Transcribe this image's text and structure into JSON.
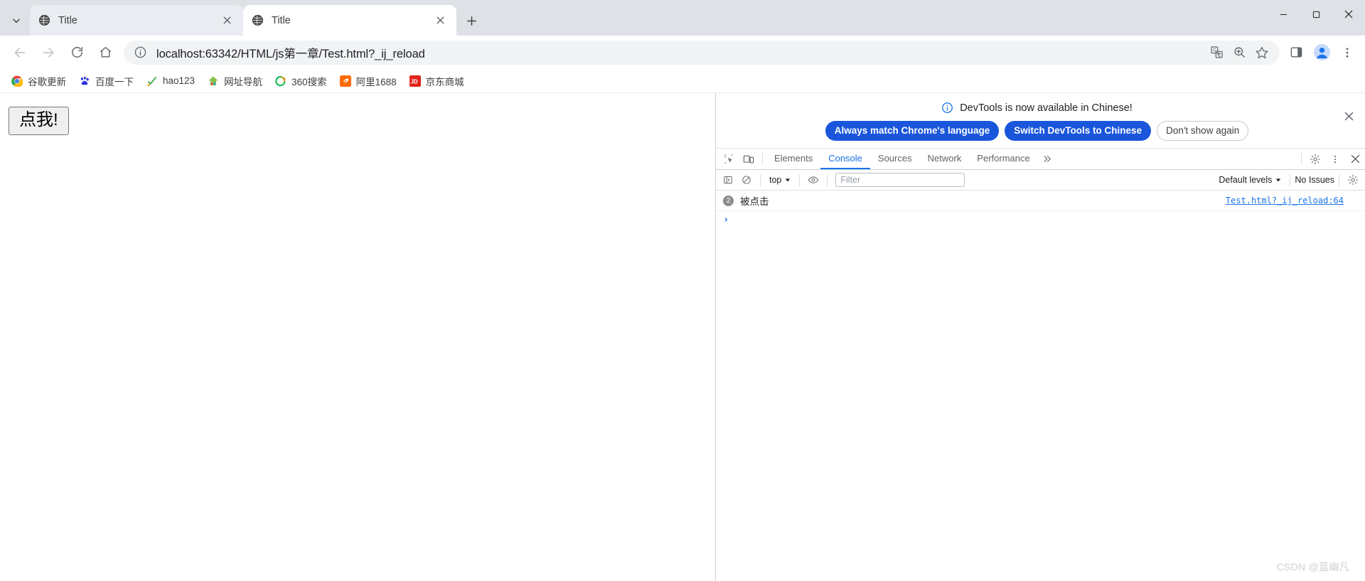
{
  "window": {
    "minimize_label": "Minimize",
    "maximize_label": "Maximize",
    "close_label": "Close"
  },
  "tabstrip": {
    "tab_search_label": "Search tabs",
    "new_tab_label": "New Tab",
    "tabs": [
      {
        "title": "Title",
        "active": false,
        "favicon": "globe-icon",
        "close_label": "Close tab"
      },
      {
        "title": "Title",
        "active": true,
        "favicon": "globe-icon",
        "close_label": "Close tab"
      }
    ]
  },
  "toolbar": {
    "back_label": "Back",
    "forward_label": "Forward",
    "reload_label": "Reload",
    "home_label": "Home",
    "url": "localhost:63342/HTML/js第一章/Test.html?_ij_reload",
    "site_info_label": "View site information",
    "translate_label": "Translate this page",
    "zoom_label": "Zoom",
    "bookmark_label": "Bookmark this tab",
    "side_panel_label": "Side panel",
    "profile_label": "Profile",
    "menu_label": "Customize and control Google Chrome"
  },
  "bookmarks": [
    {
      "label": "谷歌更新",
      "icon": "chrome-icon"
    },
    {
      "label": "百度一下",
      "icon": "baidu-paw-icon"
    },
    {
      "label": "hao123",
      "icon": "hao123-check-icon"
    },
    {
      "label": "网址导航",
      "icon": "navigation-house-icon"
    },
    {
      "label": "360搜索",
      "icon": "360-circle-icon"
    },
    {
      "label": "阿里1688",
      "icon": "alibaba-icon"
    },
    {
      "label": "京东商城",
      "icon": "jd-icon"
    }
  ],
  "page": {
    "button_label": "点我!",
    "watermark": "CSDN @蓝幽凡"
  },
  "devtools": {
    "banner": {
      "message": "DevTools is now available in Chinese!",
      "info_icon": "info-circle-icon",
      "close_label": "Close",
      "buttons": [
        {
          "label": "Always match Chrome's language",
          "style": "primary"
        },
        {
          "label": "Switch DevTools to Chinese",
          "style": "primary"
        },
        {
          "label": "Don't show again",
          "style": "ghost"
        }
      ]
    },
    "tabbar": {
      "inspect_label": "Inspect element",
      "device_toolbar_label": "Toggle device toolbar",
      "more_tabs_label": "More tabs",
      "settings_label": "Settings",
      "more_options_label": "Customize and control DevTools",
      "close_label": "Close DevTools",
      "tabs": [
        {
          "label": "Elements",
          "active": false
        },
        {
          "label": "Console",
          "active": true
        },
        {
          "label": "Sources",
          "active": false
        },
        {
          "label": "Network",
          "active": false
        },
        {
          "label": "Performance",
          "active": false
        }
      ]
    },
    "console_toolbar": {
      "sidebar_label": "Show console sidebar",
      "clear_label": "Clear console",
      "context": "top",
      "eye_label": "Create live expression",
      "filter_placeholder": "Filter",
      "filter_value": "",
      "levels": "Default levels",
      "issues": "No Issues",
      "settings_label": "Console settings"
    },
    "console": {
      "messages": [
        {
          "count": "2",
          "text": "被点击",
          "source": "Test.html?_ij_reload:64"
        }
      ],
      "prompt": "›"
    }
  },
  "colors": {
    "accent_blue": "#1a73e8",
    "banner_button_blue": "#1a56db",
    "tabstrip_bg": "#dee1e6",
    "inactive_tab_bg": "#e9ecf0",
    "badge_gray": "#8c8c8c"
  }
}
